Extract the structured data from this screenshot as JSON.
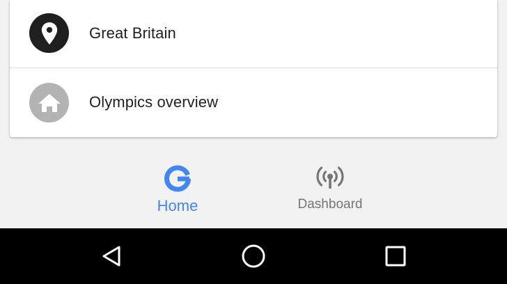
{
  "list": {
    "items": [
      {
        "label": "Great Britain",
        "icon": "location-pin-icon",
        "icon_bg": "#1f1f1f"
      },
      {
        "label": "Olympics overview",
        "icon": "home-icon",
        "icon_bg": "#b3b3b3"
      }
    ]
  },
  "bottom_nav": {
    "items": [
      {
        "label": "Home",
        "icon": "google-g-icon",
        "active": true,
        "color": "#4285f4"
      },
      {
        "label": "Dashboard",
        "icon": "broadcast-tower-icon",
        "active": false,
        "color": "#757575"
      }
    ]
  },
  "system_nav": {
    "buttons": [
      "back-icon",
      "home-circle-icon",
      "recents-icon"
    ]
  }
}
